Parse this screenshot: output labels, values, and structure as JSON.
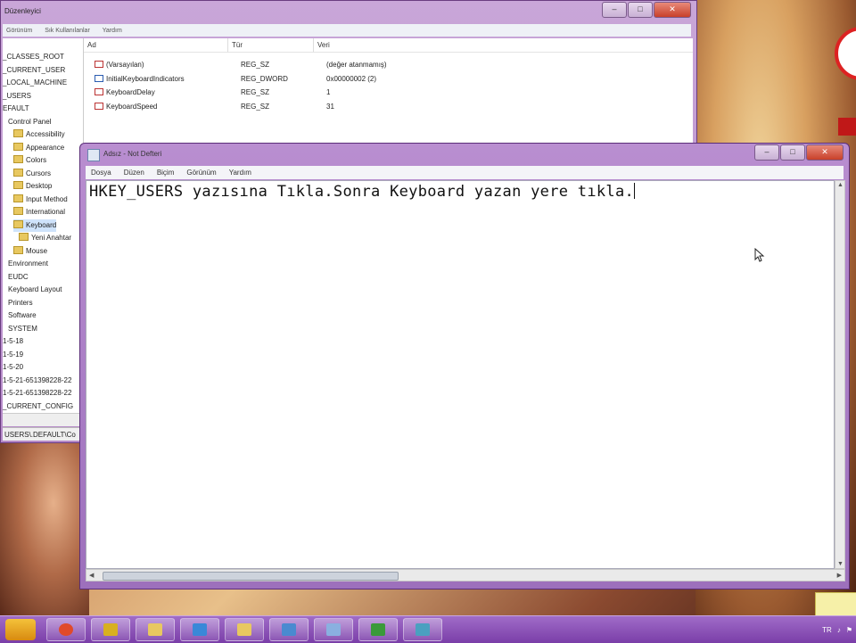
{
  "regedit": {
    "title": "Düzenleyici",
    "menu": [
      "Görünüm",
      "Sık Kullanılanlar",
      "Yardım"
    ],
    "columns": [
      "Ad",
      "Tür",
      "Veri"
    ],
    "values": [
      {
        "name": "(Varsayılan)",
        "type": "REG_SZ",
        "data": "(değer atanmamış)",
        "kind": "str"
      },
      {
        "name": "InitialKeyboardIndicators",
        "type": "REG_DWORD",
        "data": "0x00000002 (2)",
        "kind": "bin"
      },
      {
        "name": "KeyboardDelay",
        "type": "REG_SZ",
        "data": "1",
        "kind": "str"
      },
      {
        "name": "KeyboardSpeed",
        "type": "REG_SZ",
        "data": "31",
        "kind": "str"
      }
    ],
    "tree": [
      {
        "label": "_CLASSES_ROOT",
        "indent": 0,
        "folder": false
      },
      {
        "label": "_CURRENT_USER",
        "indent": 0,
        "folder": false
      },
      {
        "label": "_LOCAL_MACHINE",
        "indent": 0,
        "folder": false
      },
      {
        "label": "_USERS",
        "indent": 0,
        "folder": false
      },
      {
        "label": "EFAULT",
        "indent": 0,
        "folder": false
      },
      {
        "label": "Control Panel",
        "indent": 1,
        "folder": false
      },
      {
        "label": "Accessibility",
        "indent": 2,
        "folder": true
      },
      {
        "label": "Appearance",
        "indent": 2,
        "folder": true
      },
      {
        "label": "Colors",
        "indent": 2,
        "folder": true
      },
      {
        "label": "Cursors",
        "indent": 2,
        "folder": true
      },
      {
        "label": "Desktop",
        "indent": 2,
        "folder": true
      },
      {
        "label": "Input Method",
        "indent": 2,
        "folder": true
      },
      {
        "label": "International",
        "indent": 2,
        "folder": true
      },
      {
        "label": "Keyboard",
        "indent": 2,
        "folder": true,
        "selected": true
      },
      {
        "label": "Yeni Anahtar",
        "indent": 3,
        "folder": true
      },
      {
        "label": "Mouse",
        "indent": 2,
        "folder": true
      },
      {
        "label": "Environment",
        "indent": 1,
        "folder": false
      },
      {
        "label": "EUDC",
        "indent": 1,
        "folder": false
      },
      {
        "label": "Keyboard Layout",
        "indent": 1,
        "folder": false
      },
      {
        "label": "Printers",
        "indent": 1,
        "folder": false
      },
      {
        "label": "Software",
        "indent": 1,
        "folder": false
      },
      {
        "label": "SYSTEM",
        "indent": 1,
        "folder": false
      },
      {
        "label": "1-5-18",
        "indent": 0,
        "folder": false
      },
      {
        "label": "1-5-19",
        "indent": 0,
        "folder": false
      },
      {
        "label": "1-5-20",
        "indent": 0,
        "folder": false
      },
      {
        "label": "1-5-21-651398228-22",
        "indent": 0,
        "folder": false
      },
      {
        "label": "1-5-21-651398228-22",
        "indent": 0,
        "folder": false
      },
      {
        "label": "_CURRENT_CONFIG",
        "indent": 0,
        "folder": false
      }
    ],
    "status": "USERS\\.DEFAULT\\Co"
  },
  "notepad": {
    "title": "Adsız - Not Defteri",
    "menu": [
      "Dosya",
      "Düzen",
      "Biçim",
      "Görünüm",
      "Yardım"
    ],
    "text": "HKEY_USERS yazısına Tıkla.Sonra Keyboard yazan yere tıkla."
  },
  "caption": {
    "minimize": "–",
    "maximize": "□",
    "close": "✕"
  },
  "taskbar": {
    "apps": [
      "chrome-icon",
      "gadget-icon",
      "folder-icon",
      "network-icon",
      "explorer-icon",
      "media-icon",
      "paint-icon",
      "terminal-icon",
      "tools-icon"
    ],
    "tray_text": "TR"
  },
  "colors": {
    "window_frame": "#b58ac8",
    "taskbar": "#7a3ea8",
    "selection": "#cfe3fb"
  }
}
